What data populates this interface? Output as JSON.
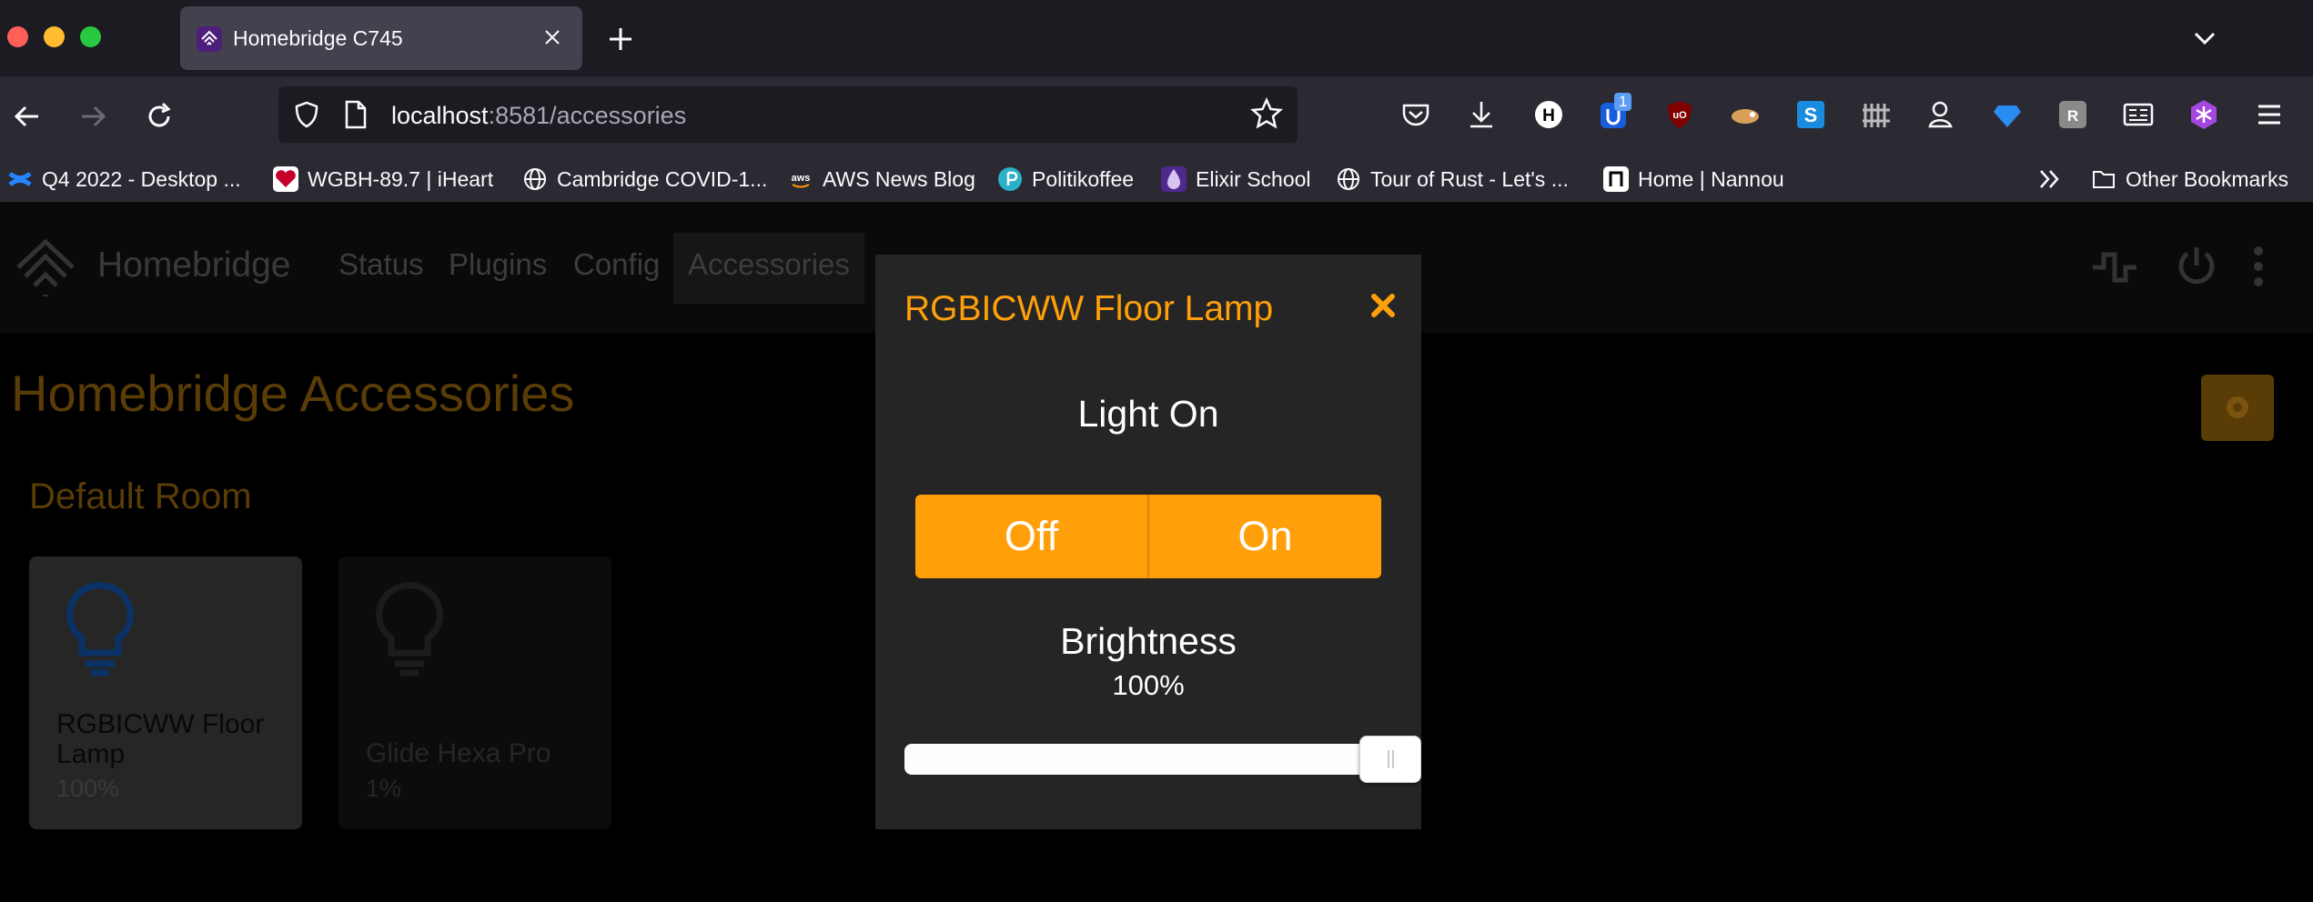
{
  "browser": {
    "tab_title": "Homebridge C745",
    "url_host": "localhost",
    "url_rest": ":8581/accessories",
    "bookmarks": [
      "Q4 2022 - Desktop ...",
      "WGBH-89.7 | iHeart",
      "Cambridge COVID-1...",
      "AWS News Blog",
      "Politikoffee",
      "Elixir School",
      "Tour of Rust - Let's ...",
      "Home | Nannou"
    ],
    "other_bookmarks": "Other Bookmarks",
    "extension_badge": "1",
    "colors": {
      "tabbar": "#1c1b22",
      "toolbar": "#2b2a33",
      "tab_active": "#42414d"
    }
  },
  "app": {
    "brand": "Homebridge",
    "nav": [
      "Status",
      "Plugins",
      "Config",
      "Accessories"
    ],
    "page_title": "Homebridge Accessories",
    "room_title": "Default Room",
    "tiles": [
      {
        "name_line1": "RGBICWW Floor",
        "name_line2": "Lamp",
        "value": "100%"
      },
      {
        "name_line1": "Glide Hexa Pro",
        "name_line2": "",
        "value": "1%"
      }
    ],
    "colors": {
      "accent": "#ff9f0a"
    }
  },
  "modal": {
    "title": "RGBICWW Floor Lamp",
    "light_label": "Light On",
    "off_label": "Off",
    "on_label": "On",
    "brightness_label": "Brightness",
    "brightness_value": "100%",
    "brightness_level": 1.0
  }
}
